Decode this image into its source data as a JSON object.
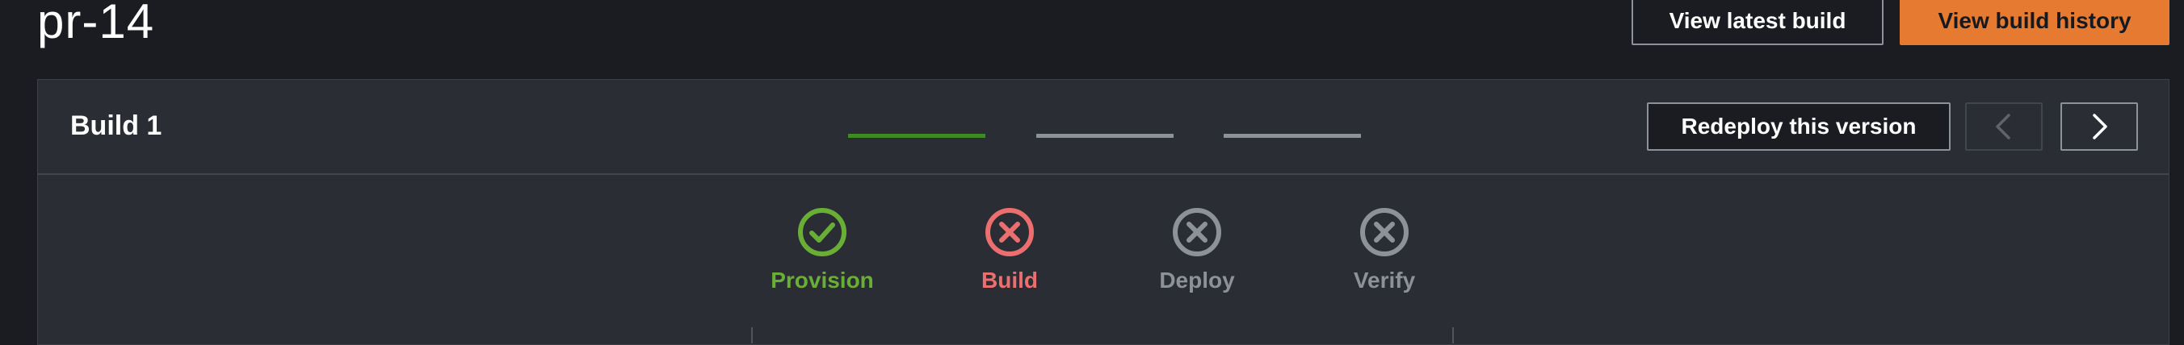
{
  "header": {
    "title": "pr-14",
    "view_latest_label": "View latest build",
    "view_history_label": "View build history"
  },
  "panel": {
    "title": "Build 1",
    "redeploy_label": "Redeploy this version"
  },
  "steps": [
    {
      "label": "Provision",
      "status": "success",
      "icon": "check-circle-icon",
      "color": "#6aaf35"
    },
    {
      "label": "Build",
      "status": "failed",
      "icon": "x-circle-icon",
      "color": "#eb6f6f"
    },
    {
      "label": "Deploy",
      "status": "not-run",
      "icon": "x-circle-icon",
      "color": "#8d9299"
    },
    {
      "label": "Verify",
      "status": "not-run",
      "icon": "x-circle-icon",
      "color": "#8d9299"
    }
  ],
  "colors": {
    "accent": "#e57a30",
    "success": "#6aaf35",
    "error": "#eb6f6f",
    "inactive": "#8d9299",
    "connector_success": "#3e8b24"
  }
}
